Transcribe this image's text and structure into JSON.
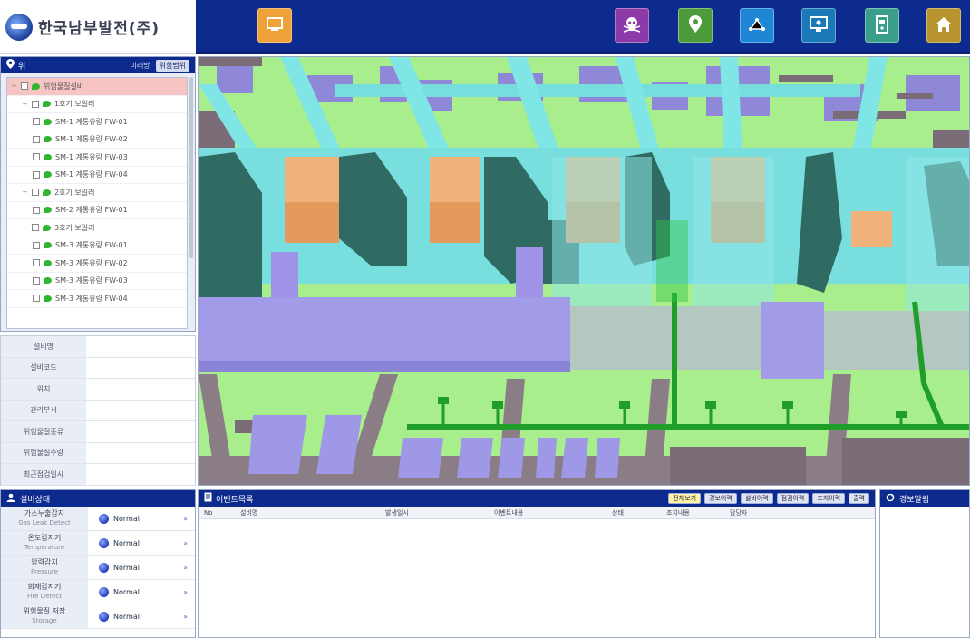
{
  "logo": {
    "name": "한국남부발전(주)"
  },
  "topbar": {
    "buttons": [
      {
        "name": "layer-button",
        "icon": "layer-icon",
        "color": "#f0a23a"
      },
      {
        "name": "hazard-button",
        "icon": "skull-icon",
        "color": "#8c3aa8"
      },
      {
        "name": "location-button",
        "icon": "location-pin-icon",
        "color": "#4b9b3a"
      },
      {
        "name": "network-button",
        "icon": "network-icon",
        "color": "#1f86d6"
      },
      {
        "name": "monitor-button",
        "icon": "monitor-icon",
        "color": "#1b79b9"
      },
      {
        "name": "device-button",
        "icon": "device-icon",
        "color": "#3a9e8a"
      },
      {
        "name": "home-button",
        "icon": "home-icon",
        "color": "#b8942e"
      }
    ]
  },
  "tree_panel": {
    "title": "위",
    "actions": [
      "미래방",
      "위험범위"
    ],
    "rows": [
      {
        "label": "위험물질설비",
        "level": 0,
        "selected": true
      },
      {
        "label": "1호기 보일러",
        "level": 1
      },
      {
        "label": "SM-1 계통유량 FW-01",
        "level": 2
      },
      {
        "label": "SM-1 계통유량 FW-02",
        "level": 2
      },
      {
        "label": "SM-1 계통유량 FW-03",
        "level": 2
      },
      {
        "label": "SM-1 계통유량 FW-04",
        "level": 2
      },
      {
        "label": "2호기 보일러",
        "level": 1
      },
      {
        "label": "SM-2 계통유량 FW-01",
        "level": 2
      },
      {
        "label": "3호기 보일러",
        "level": 1
      },
      {
        "label": "SM-3 계통유량 FW-01",
        "level": 2
      },
      {
        "label": "SM-3 계통유량 FW-02",
        "level": 2
      },
      {
        "label": "SM-3 계통유량 FW-03",
        "level": 2
      },
      {
        "label": "SM-3 계통유량 FW-04",
        "level": 2
      }
    ]
  },
  "props": {
    "rows": [
      "설비명",
      "설비코드",
      "위치",
      "관리부서",
      "위험물질종류",
      "위험물질수량",
      "최근점검일시"
    ]
  },
  "status_panel": {
    "title": "설비상태",
    "rows": [
      {
        "label": "가스누출감지",
        "sub": "Gas Leak Detect",
        "value": "Normal"
      },
      {
        "label": "온도감지기",
        "sub": "Temperature",
        "value": "Normal"
      },
      {
        "label": "압력감지",
        "sub": "Pressure",
        "value": "Normal"
      },
      {
        "label": "화재감지기",
        "sub": "Fire Detect",
        "value": "Normal"
      },
      {
        "label": "위험물질 저장",
        "sub": "Storage",
        "value": "Normal"
      }
    ]
  },
  "list_panel": {
    "title": "이벤트목록",
    "buttons": [
      "전체보기",
      "경보이력",
      "설비이력",
      "점검이력",
      "조치이력",
      "출력"
    ],
    "columns": [
      "No",
      "설비명",
      "발생일시",
      "이벤트내용",
      "상태",
      "조치내용",
      "담당자"
    ]
  },
  "alarm_panel": {
    "title": "경보알림"
  }
}
